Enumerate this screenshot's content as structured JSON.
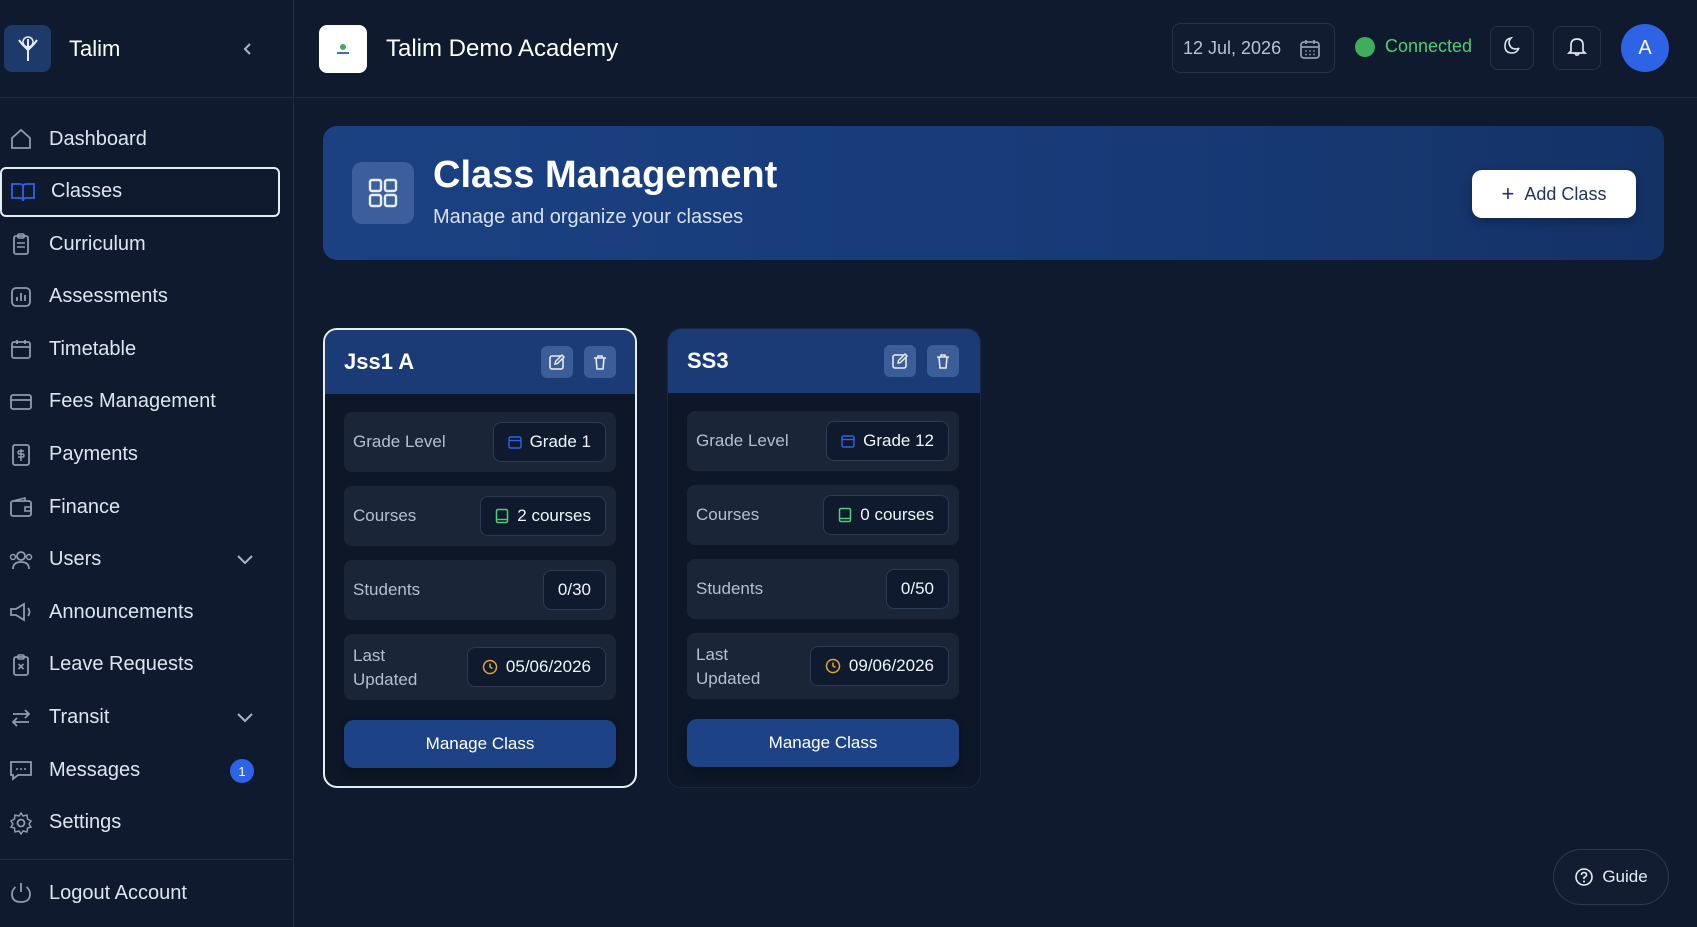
{
  "app": {
    "name": "Talim"
  },
  "sidebar": {
    "items": [
      {
        "label": "Dashboard",
        "icon": "home-icon"
      },
      {
        "label": "Classes",
        "icon": "book-open-icon",
        "active": true
      },
      {
        "label": "Curriculum",
        "icon": "clipboard-icon"
      },
      {
        "label": "Assessments",
        "icon": "bar-chart-icon"
      },
      {
        "label": "Timetable",
        "icon": "calendar-icon"
      },
      {
        "label": "Fees Management",
        "icon": "credit-card-icon"
      },
      {
        "label": "Payments",
        "icon": "receipt-icon"
      },
      {
        "label": "Finance",
        "icon": "wallet-icon"
      },
      {
        "label": "Users",
        "icon": "users-icon",
        "expandable": true
      },
      {
        "label": "Announcements",
        "icon": "megaphone-icon"
      },
      {
        "label": "Leave Requests",
        "icon": "clipboard-x-icon"
      },
      {
        "label": "Transit",
        "icon": "arrows-swap-icon",
        "expandable": true
      },
      {
        "label": "Messages",
        "icon": "message-icon",
        "badge": "1"
      },
      {
        "label": "Settings",
        "icon": "gear-icon"
      }
    ],
    "logout_label": "Logout Account"
  },
  "header": {
    "school_name": "Talim Demo Academy",
    "date": "12 Jul, 2026",
    "connection_status": "Connected",
    "avatar_initial": "A"
  },
  "banner": {
    "title": "Class Management",
    "subtitle": "Manage and organize your classes",
    "add_button_label": "Add Class"
  },
  "classes": [
    {
      "name": "Jss1 A",
      "grade_label": "Grade Level",
      "grade": "Grade 1",
      "courses_label": "Courses",
      "courses": "2 courses",
      "students_label": "Students",
      "students": "0/30",
      "updated_label_1": "Last",
      "updated_label_2": "Updated",
      "updated": "05/06/2026",
      "manage_label": "Manage Class"
    },
    {
      "name": "SS3",
      "grade_label": "Grade Level",
      "grade": "Grade 12",
      "courses_label": "Courses",
      "courses": "0 courses",
      "students_label": "Students",
      "students": "0/50",
      "updated_label_1": "Last",
      "updated_label_2": "Updated",
      "updated": "09/06/2026",
      "manage_label": "Manage Class"
    }
  ],
  "guide": {
    "label": "Guide"
  },
  "colors": {
    "background": "#0f1a2e",
    "accent": "#2f63e6",
    "banner": "#1b4183",
    "connected": "#4fcf72"
  }
}
